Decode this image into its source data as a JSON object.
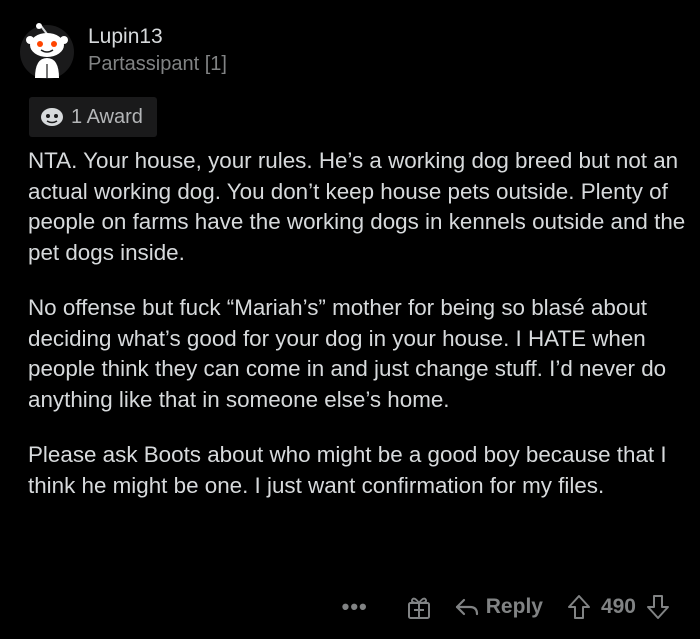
{
  "comment": {
    "author": "Lupin13",
    "flair": "Partassipant [1]",
    "award_label": "1 Award",
    "paragraphs": [
      "NTA. Your house, your rules. He’s a working dog breed but not an actual working dog. You don’t keep house pets outside. Plenty of people on farms have the working dogs in kennels outside and the pet dogs inside.",
      "No offense but fuck “Mariah’s” mother for being so blasé about deciding what’s good for your dog in your house. I HATE when people think they can come in and just change stuff. I’d never do anything like that in someone else’s home.",
      "Please ask Boots about who might be a good boy because that I think he might be one. I just want confirmation for my files."
    ]
  },
  "actions": {
    "more": "•••",
    "reply_label": "Reply",
    "score": "490"
  },
  "icons": {
    "avatar": "reddit-snoo-avatar",
    "award": "award-icon",
    "give_award": "give-award-icon",
    "reply": "reply-arrow-icon",
    "upvote": "upvote-arrow-icon",
    "downvote": "downvote-arrow-icon"
  },
  "colors": {
    "background": "#000000",
    "text": "#d7dadc",
    "muted": "#818384",
    "chip": "#1a1a1b",
    "snoo_eye": "#ff4500"
  }
}
